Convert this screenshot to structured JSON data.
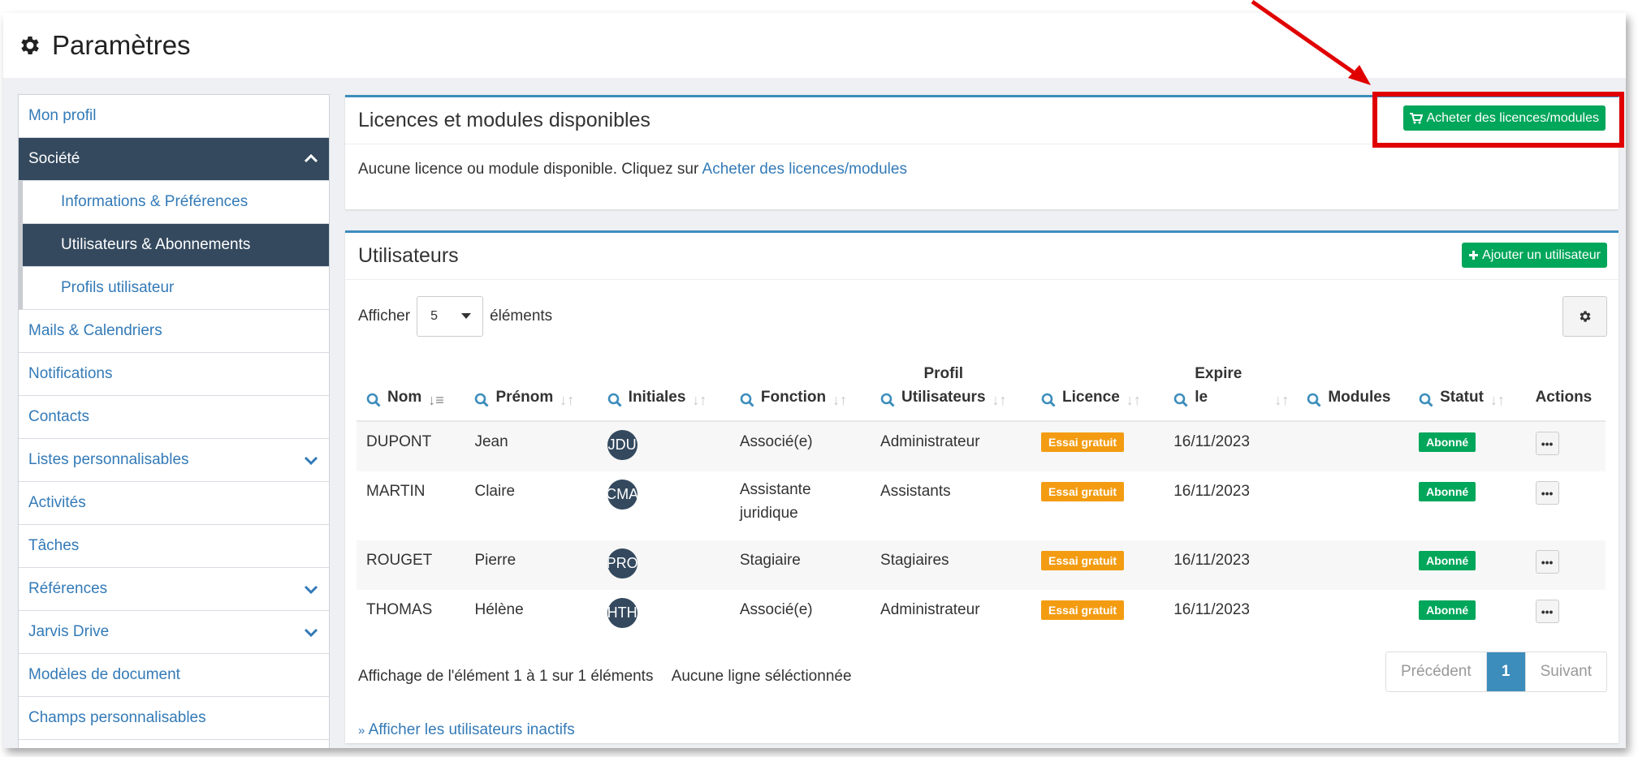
{
  "header": {
    "title": "Paramètres",
    "icon": "gear-icon"
  },
  "sidebar": {
    "items": [
      {
        "label": "Mon profil"
      },
      {
        "label": "Société"
      },
      {
        "label": "Informations & Préférences"
      },
      {
        "label": "Utilisateurs & Abonnements"
      },
      {
        "label": "Profils utilisateur"
      },
      {
        "label": "Mails & Calendriers"
      },
      {
        "label": "Notifications"
      },
      {
        "label": "Contacts"
      },
      {
        "label": "Listes personnalisables"
      },
      {
        "label": "Activités"
      },
      {
        "label": "Tâches"
      },
      {
        "label": "Références"
      },
      {
        "label": "Jarvis Drive"
      },
      {
        "label": "Modèles de document"
      },
      {
        "label": "Champs personnalisables"
      }
    ]
  },
  "licenses": {
    "title": "Licences et modules disponibles",
    "buy_button": "Acheter des licences/modules",
    "empty_text": "Aucune licence ou module disponible. Cliquez sur ",
    "empty_link": "Acheter des licences/modules"
  },
  "users": {
    "title": "Utilisateurs",
    "add_button": "Ajouter un utilisateur",
    "show_label": "Afficher",
    "page_size": "5",
    "elements_label": "éléments",
    "columns": [
      {
        "line1": "",
        "line2": "Nom"
      },
      {
        "line1": "",
        "line2": "Prénom"
      },
      {
        "line1": "",
        "line2": "Initiales"
      },
      {
        "line1": "",
        "line2": "Fonction"
      },
      {
        "line1": "Profil",
        "line2": "Utilisateurs"
      },
      {
        "line1": "",
        "line2": "Licence"
      },
      {
        "line1": "Expire",
        "line2": "le"
      },
      {
        "line1": "",
        "line2": "Modules"
      },
      {
        "line1": "",
        "line2": "Statut"
      },
      {
        "line1": "",
        "line2": "Actions"
      }
    ],
    "rows": [
      {
        "nom": "DUPONT",
        "prenom": "Jean",
        "initiales": "JDU",
        "fonction": "Associé(e)",
        "profil": "Administrateur",
        "licence": "Essai gratuit",
        "expire": "16/11/2023",
        "modules": "",
        "statut": "Abonné",
        "actions": "•••"
      },
      {
        "nom": "MARTIN",
        "prenom": "Claire",
        "initiales": "CMA",
        "fonction": "Assistante juridique",
        "profil": "Assistants",
        "licence": "Essai gratuit",
        "expire": "16/11/2023",
        "modules": "",
        "statut": "Abonné",
        "actions": "•••"
      },
      {
        "nom": "ROUGET",
        "prenom": "Pierre",
        "initiales": "PRO",
        "fonction": "Stagiaire",
        "profil": "Stagiaires",
        "licence": "Essai gratuit",
        "expire": "16/11/2023",
        "modules": "",
        "statut": "Abonné",
        "actions": "•••"
      },
      {
        "nom": "THOMAS",
        "prenom": "Hélène",
        "initiales": "HTH",
        "fonction": "Associé(e)",
        "profil": "Administrateur",
        "licence": "Essai gratuit",
        "expire": "16/11/2023",
        "modules": "",
        "statut": "Abonné",
        "actions": "•••"
      }
    ],
    "info": "Affichage de l'élément 1 à 1 sur 1 éléments",
    "selection": "Aucune ligne séléctionnée",
    "pager": {
      "prev": "Précédent",
      "current": "1",
      "next": "Suivant"
    },
    "inactive_link": "Afficher les utilisateurs inactifs"
  },
  "colors": {
    "accent": "#3c8dbc",
    "nav_active": "#34495e",
    "green": "#00a65a",
    "orange": "#f39c12",
    "link": "#337ab7",
    "highlight": "#e00000"
  }
}
